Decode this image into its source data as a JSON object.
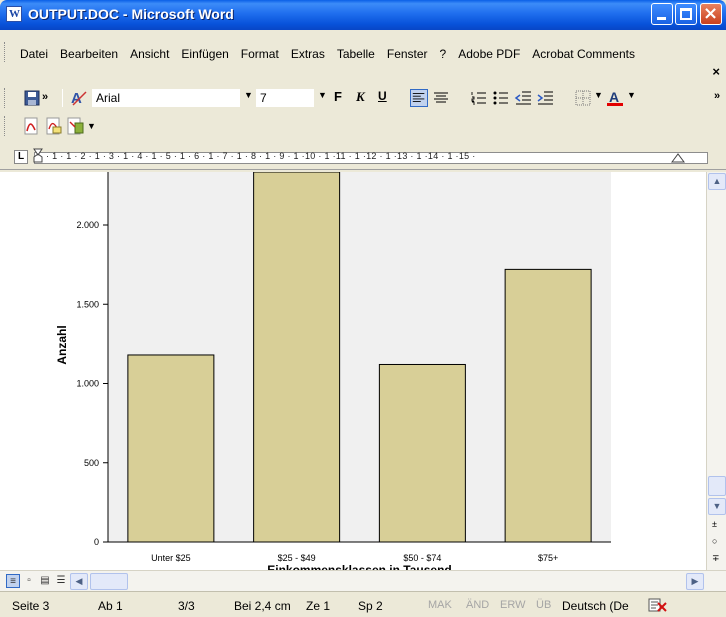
{
  "window": {
    "title": "OUTPUT.DOC - Microsoft Word"
  },
  "menu": {
    "items": [
      "Datei",
      "Bearbeiten",
      "Ansicht",
      "Einfügen",
      "Format",
      "Extras",
      "Tabelle",
      "Fenster",
      "?",
      "Adobe PDF",
      "Acrobat Comments"
    ],
    "close_glyph": "×"
  },
  "toolbar": {
    "font_name": "Arial",
    "font_size": "7",
    "bold_label": "F",
    "italic_label": "K",
    "underline_label": "U",
    "overflow_glyph": "»",
    "icons": [
      "save-icon",
      "styles-icon",
      "bold-icon",
      "italic-icon",
      "underline-icon",
      "align-left-icon",
      "align-center-icon",
      "numbered-list-icon",
      "bullet-list-icon",
      "decrease-indent-icon",
      "increase-indent-icon",
      "border-icon",
      "font-color-icon",
      "pdf-convert-icon",
      "pdf-email-icon",
      "pdf-review-icon"
    ]
  },
  "ruler": {
    "text": "· 1 · 1 · 2 · 1 · 3 · 1 · 4 · 1 · 5 · 1 · 6 · 1 · 7 · 1 · 8 · 1 · 9 · 1 ·10 · 1 ·11 · 1 ·12 · 1 ·13 · 1 ·14 · 1 ·15 ·"
  },
  "chart_data": {
    "type": "bar",
    "categories": [
      "Unter $25",
      "$25 - $49",
      "$50 - $74",
      "$75+"
    ],
    "values": [
      1180,
      2400,
      1120,
      1720
    ],
    "ylabel": "Anzahl",
    "xlabel": "Einkommensklassen in Tausend",
    "yticks": [
      0,
      500,
      1000,
      1500,
      2000
    ],
    "ytick_labels": [
      "0",
      "500",
      "1.000",
      "1.500",
      "2.000"
    ],
    "ylim": [
      0,
      2300
    ],
    "bar_color": "#D8CF97",
    "plot_background": "#F0F0F0"
  },
  "statusbar": {
    "page": "Seite 3",
    "section": "Ab 1",
    "pages": "3/3",
    "position": "Bei 2,4 cm",
    "line": "Ze 1",
    "column": "Sp 2",
    "mak": "MAK",
    "and": "ÄND",
    "erw": "ERW",
    "ub": "ÜB",
    "language": "Deutsch (De"
  },
  "colors": {
    "titlebar": "#0A5FE6",
    "chrome": "#ECE9D8"
  }
}
